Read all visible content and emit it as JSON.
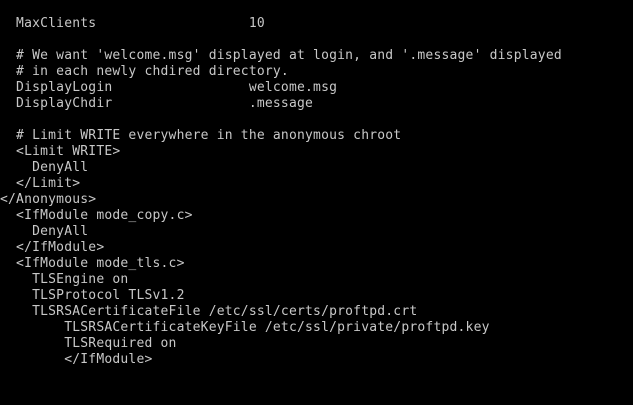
{
  "terminal": {
    "lines": [
      "  MaxClients                   10",
      "",
      "  # We want 'welcome.msg' displayed at login, and '.message' displayed",
      "  # in each newly chdired directory.",
      "  DisplayLogin                 welcome.msg",
      "  DisplayChdir                 .message",
      "",
      "  # Limit WRITE everywhere in the anonymous chroot",
      "  <Limit WRITE>",
      "    DenyAll",
      "  </Limit>",
      "</Anonymous>",
      "  <IfModule mode_copy.c>",
      "    DenyAll",
      "  </IfModule>",
      "  <IfModule mode_tls.c>",
      "    TLSEngine on",
      "    TLSProtocol TLSv1.2",
      "    TLSRSACertificateFile /etc/ssl/certs/proftpd.crt",
      "        TLSRSACertificateKeyFile /etc/ssl/private/proftpd.key",
      "        TLSRequired on",
      "        </IfModule>"
    ]
  }
}
